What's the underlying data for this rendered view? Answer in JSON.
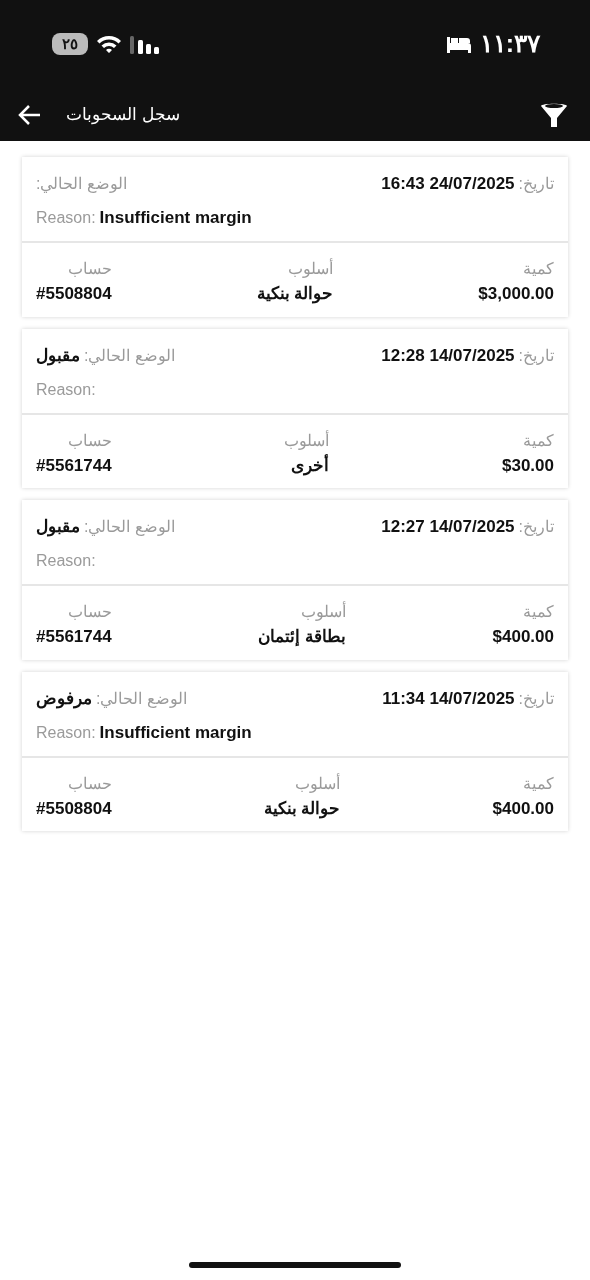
{
  "status_bar": {
    "time": "١١:٣٧",
    "battery": "٢٥"
  },
  "app_bar": {
    "title": "سجل السحوبات"
  },
  "withdrawals": [
    {
      "date": {
        "label": "تاريخ:",
        "value": "16:43 24/07/2025"
      },
      "status": {
        "label": "الوضع الحالي:"
      },
      "reason": {
        "label": "Reason:",
        "value": "Insufficient margin"
      },
      "amount": {
        "label": "كمية",
        "value": "$3,000.00"
      },
      "method": {
        "label": "أسلوب",
        "value": "حوالة بنكية"
      },
      "account": {
        "label": "حساب",
        "value": "#5508804"
      }
    },
    {
      "date": {
        "label": "تاريخ:",
        "value": "12:28 14/07/2025"
      },
      "status": {
        "label": "الوضع الحالي:",
        "value": "مقبول"
      },
      "reason": {
        "label": "Reason:"
      },
      "amount": {
        "label": "كمية",
        "value": "$30.00"
      },
      "method": {
        "label": "أسلوب",
        "value": "أخرى"
      },
      "account": {
        "label": "حساب",
        "value": "#5561744"
      }
    },
    {
      "date": {
        "label": "تاريخ:",
        "value": "12:27 14/07/2025"
      },
      "status": {
        "label": "الوضع الحالي:",
        "value": "مقبول"
      },
      "reason": {
        "label": "Reason:"
      },
      "amount": {
        "label": "كمية",
        "value": "$400.00"
      },
      "method": {
        "label": "أسلوب",
        "value": "بطاقة إئتمان"
      },
      "account": {
        "label": "حساب",
        "value": "#5561744"
      }
    },
    {
      "date": {
        "label": "تاريخ:",
        "value": "11:34 14/07/2025"
      },
      "status": {
        "label": "الوضع الحالي:",
        "value": "مرفوض"
      },
      "reason": {
        "label": "Reason:",
        "value": "Insufficient margin"
      },
      "amount": {
        "label": "كمية",
        "value": "$400.00"
      },
      "method": {
        "label": "أسلوب",
        "value": "حوالة بنكية"
      },
      "account": {
        "label": "حساب",
        "value": "#5508804"
      }
    }
  ]
}
